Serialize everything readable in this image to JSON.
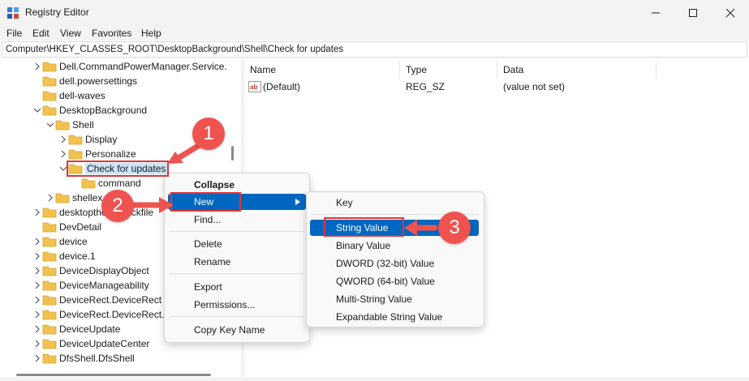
{
  "window": {
    "title": "Registry Editor",
    "icon": "regedit-icon"
  },
  "menubar": [
    "File",
    "Edit",
    "View",
    "Favorites",
    "Help"
  ],
  "address": "Computer\\HKEY_CLASSES_ROOT\\DesktopBackground\\Shell\\Check for updates",
  "tree": [
    {
      "label": "Dell.CommandPowerManager.Service.",
      "indent": 0,
      "expander": "collapsed"
    },
    {
      "label": "dell.powersettings",
      "indent": 0,
      "expander": "none"
    },
    {
      "label": "dell-waves",
      "indent": 0,
      "expander": "none"
    },
    {
      "label": "DesktopBackground",
      "indent": 0,
      "expander": "expanded"
    },
    {
      "label": "Shell",
      "indent": 1,
      "expander": "expanded"
    },
    {
      "label": "Display",
      "indent": 2,
      "expander": "collapsed"
    },
    {
      "label": "Personalize",
      "indent": 2,
      "expander": "collapsed"
    },
    {
      "label": "Check for updates",
      "indent": 2,
      "expander": "expanded",
      "selected": true
    },
    {
      "label": "command",
      "indent": 3,
      "expander": "none"
    },
    {
      "label": "shellex",
      "indent": 1,
      "expander": "collapsed"
    },
    {
      "label": "desktopthemepackfile",
      "indent": 0,
      "expander": "collapsed"
    },
    {
      "label": "DevDetail",
      "indent": 0,
      "expander": "none"
    },
    {
      "label": "device",
      "indent": 0,
      "expander": "collapsed"
    },
    {
      "label": "device.1",
      "indent": 0,
      "expander": "collapsed"
    },
    {
      "label": "DeviceDisplayObject",
      "indent": 0,
      "expander": "collapsed"
    },
    {
      "label": "DeviceManageability",
      "indent": 0,
      "expander": "collapsed"
    },
    {
      "label": "DeviceRect.DeviceRect",
      "indent": 0,
      "expander": "collapsed"
    },
    {
      "label": "DeviceRect.DeviceRect.1",
      "indent": 0,
      "expander": "collapsed"
    },
    {
      "label": "DeviceUpdate",
      "indent": 0,
      "expander": "collapsed"
    },
    {
      "label": "DeviceUpdateCenter",
      "indent": 0,
      "expander": "collapsed"
    },
    {
      "label": "DfsShell.DfsShell",
      "indent": 0,
      "expander": "collapsed"
    }
  ],
  "values_table": {
    "headers": {
      "name": "Name",
      "type": "Type",
      "data": "Data"
    },
    "rows": [
      {
        "name": "(Default)",
        "type": "REG_SZ",
        "data": "(value not set)",
        "icon": "ab-string-icon"
      }
    ]
  },
  "context_menu": {
    "collapse": "Collapse",
    "new": "New",
    "find": "Find...",
    "delete": "Delete",
    "rename": "Rename",
    "export": "Export",
    "permissions": "Permissions...",
    "copy_key_name": "Copy Key Name"
  },
  "new_submenu": {
    "key": "Key",
    "string_value": "String Value",
    "binary_value": "Binary Value",
    "dword_value": "DWORD (32-bit) Value",
    "qword_value": "QWORD (64-bit) Value",
    "multi_string_value": "Multi-String Value",
    "expandable_string_value": "Expandable String Value"
  },
  "annotations": {
    "step1": "1",
    "step2": "2",
    "step3": "3",
    "color": "#ef5350"
  },
  "colors": {
    "highlight": "#0067c0",
    "selection": "#cce4f7",
    "folder": "#f2c14e",
    "callout": "#d9383a"
  }
}
